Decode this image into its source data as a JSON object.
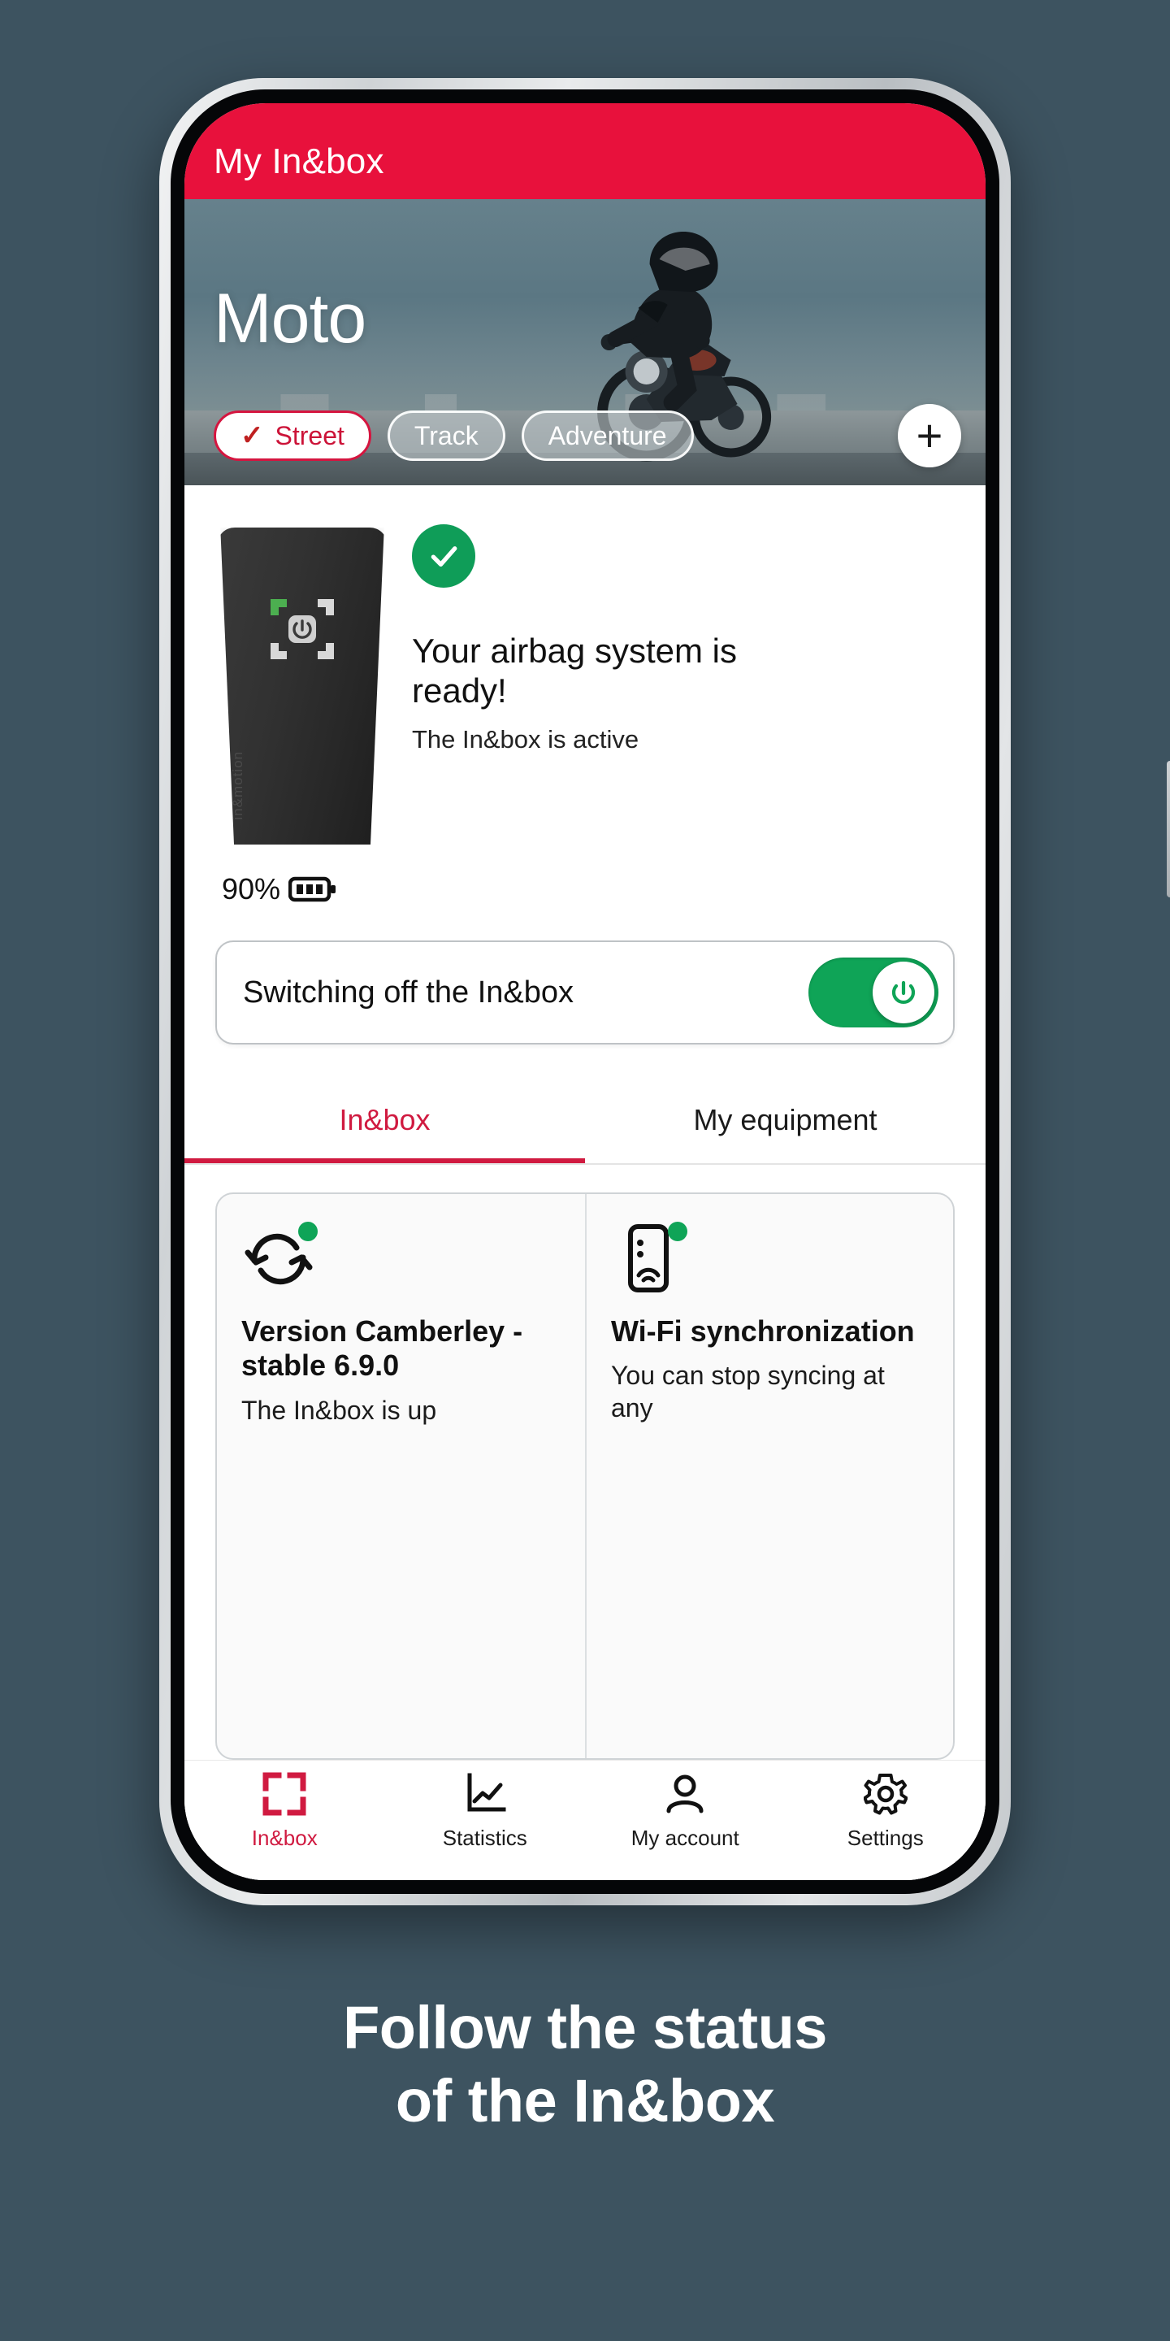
{
  "app": {
    "header_title": "My In&box"
  },
  "hero": {
    "title": "Moto",
    "chips": [
      {
        "label": "Street",
        "selected": true,
        "check_icon": "check-icon"
      },
      {
        "label": "Track",
        "selected": false
      },
      {
        "label": "Adventure",
        "selected": false
      }
    ],
    "add_button_label": "+"
  },
  "status": {
    "badge_icon": "check-circle-icon",
    "headline": "Your airbag system is ready!",
    "subtitle": "The In&box is active",
    "device_brand": "in&motion",
    "device_logo_icon": "bracket-power-icon"
  },
  "battery": {
    "percent_label": "90%",
    "icon": "battery-icon"
  },
  "power_toggle": {
    "label": "Switching off the In&box",
    "state_on": true,
    "knob_icon": "power-icon"
  },
  "tabs": [
    {
      "label": "In&box",
      "active": true
    },
    {
      "label": "My equipment",
      "active": false
    }
  ],
  "info_cards": [
    {
      "icon": "sync-icon",
      "status_dot": "green",
      "title": "Version Camberley - stable 6.9.0",
      "description": "The In&box is up"
    },
    {
      "icon": "phone-wifi-icon",
      "status_dot": "green",
      "title": "Wi-Fi synchronization",
      "description": "You can stop syncing at any"
    }
  ],
  "bottom_nav": [
    {
      "label": "In&box",
      "icon": "bracket-icon",
      "active": true
    },
    {
      "label": "Statistics",
      "icon": "chart-line-icon",
      "active": false
    },
    {
      "label": "My account",
      "icon": "person-icon",
      "active": false
    },
    {
      "label": "Settings",
      "icon": "gear-icon",
      "active": false
    }
  ],
  "caption": {
    "line1": "Follow the status",
    "line2": "of the In&box"
  },
  "colors": {
    "brand_red": "#e8113c",
    "accent_red": "#d01a40",
    "green": "#0fa457",
    "page_background": "#3d5360"
  }
}
